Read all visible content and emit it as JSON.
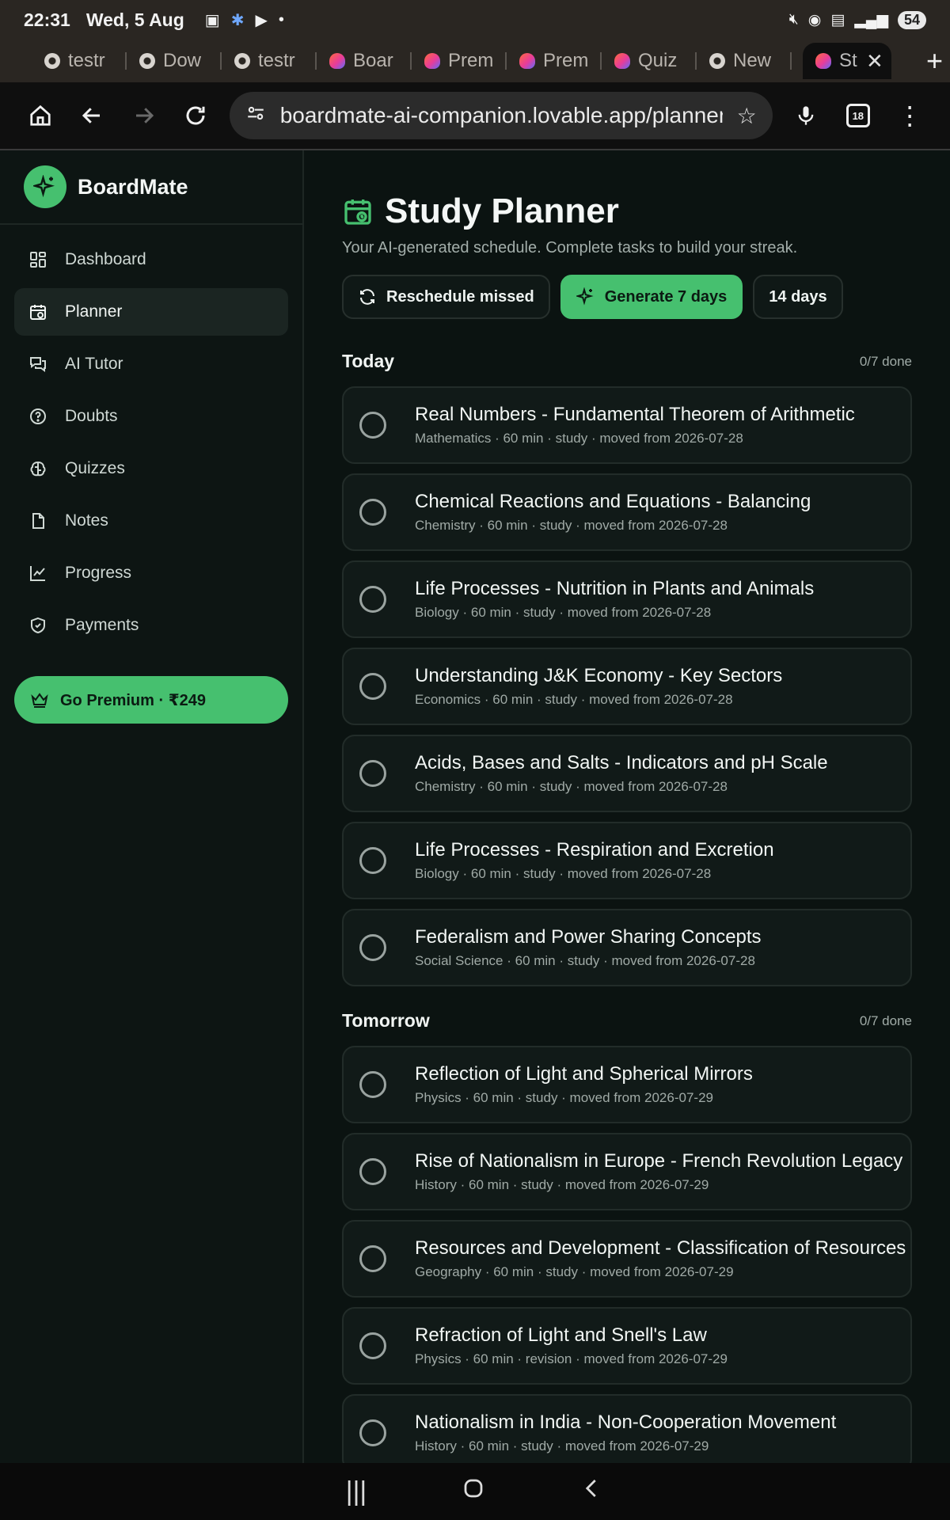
{
  "status_bar": {
    "time": "22:31",
    "date": "Wed, 5 Aug",
    "battery": "54"
  },
  "browser": {
    "tabs": [
      {
        "label": "testr",
        "favicon": "chrome"
      },
      {
        "label": "Dow",
        "favicon": "chrome"
      },
      {
        "label": "testr",
        "favicon": "chrome"
      },
      {
        "label": "Boar",
        "favicon": "lovable"
      },
      {
        "label": "Prem",
        "favicon": "lovable"
      },
      {
        "label": "Prem",
        "favicon": "lovable"
      },
      {
        "label": "Quiz",
        "favicon": "lovable"
      },
      {
        "label": "New",
        "favicon": "chrome"
      }
    ],
    "active_tab": {
      "label": "St",
      "favicon": "lovable"
    },
    "url": "boardmate-ai-companion.lovable.app/planner",
    "tab_count": "18"
  },
  "sidebar": {
    "brand": "BoardMate",
    "items": [
      {
        "label": "Dashboard",
        "icon": "grid-icon",
        "active": false
      },
      {
        "label": "Planner",
        "icon": "calendar-clock-icon",
        "active": true
      },
      {
        "label": "AI Tutor",
        "icon": "chat-icon",
        "active": false
      },
      {
        "label": "Doubts",
        "icon": "help-circle-icon",
        "active": false
      },
      {
        "label": "Quizzes",
        "icon": "brain-icon",
        "active": false
      },
      {
        "label": "Notes",
        "icon": "file-icon",
        "active": false
      },
      {
        "label": "Progress",
        "icon": "chart-line-icon",
        "active": false
      },
      {
        "label": "Payments",
        "icon": "shield-icon",
        "active": false
      }
    ],
    "premium_label": "Go Premium · ₹249"
  },
  "page": {
    "title": "Study Planner",
    "subtitle": "Your AI-generated schedule. Complete tasks to build your streak.",
    "buttons": {
      "reschedule": "Reschedule missed",
      "generate": "Generate 7 days",
      "fourteen": "14 days"
    }
  },
  "today": {
    "title": "Today",
    "count": "0/7 done",
    "tasks": [
      {
        "title": "Real Numbers - Fundamental Theorem of Arithmetic",
        "meta": "Mathematics · 60 min · study · moved from 2026-07-28"
      },
      {
        "title": "Chemical Reactions and Equations - Balancing",
        "meta": "Chemistry · 60 min · study · moved from 2026-07-28"
      },
      {
        "title": "Life Processes - Nutrition in Plants and Animals",
        "meta": "Biology · 60 min · study · moved from 2026-07-28"
      },
      {
        "title": "Understanding J&K Economy - Key Sectors",
        "meta": "Economics · 60 min · study · moved from 2026-07-28"
      },
      {
        "title": "Acids, Bases and Salts - Indicators and pH Scale",
        "meta": "Chemistry · 60 min · study · moved from 2026-07-28"
      },
      {
        "title": "Life Processes - Respiration and Excretion",
        "meta": "Biology · 60 min · study · moved from 2026-07-28"
      },
      {
        "title": "Federalism and Power Sharing Concepts",
        "meta": "Social Science · 60 min · study · moved from 2026-07-28"
      }
    ]
  },
  "tomorrow": {
    "title": "Tomorrow",
    "count": "0/7 done",
    "tasks": [
      {
        "title": "Reflection of Light and Spherical Mirrors",
        "meta": "Physics · 60 min · study · moved from 2026-07-29"
      },
      {
        "title": "Rise of Nationalism in Europe - French Revolution Legacy",
        "meta": "History · 60 min · study · moved from 2026-07-29"
      },
      {
        "title": "Resources and Development - Classification of Resources",
        "meta": "Geography · 60 min · study · moved from 2026-07-29"
      },
      {
        "title": "Refraction of Light and Snell's Law",
        "meta": "Physics · 60 min · revision · moved from 2026-07-29"
      },
      {
        "title": "Nationalism in India - Non-Cooperation Movement",
        "meta": "History · 60 min · study · moved from 2026-07-29"
      }
    ]
  },
  "colors": {
    "accent": "#46c06f",
    "background": "#0b1311",
    "card": "#111a18"
  }
}
